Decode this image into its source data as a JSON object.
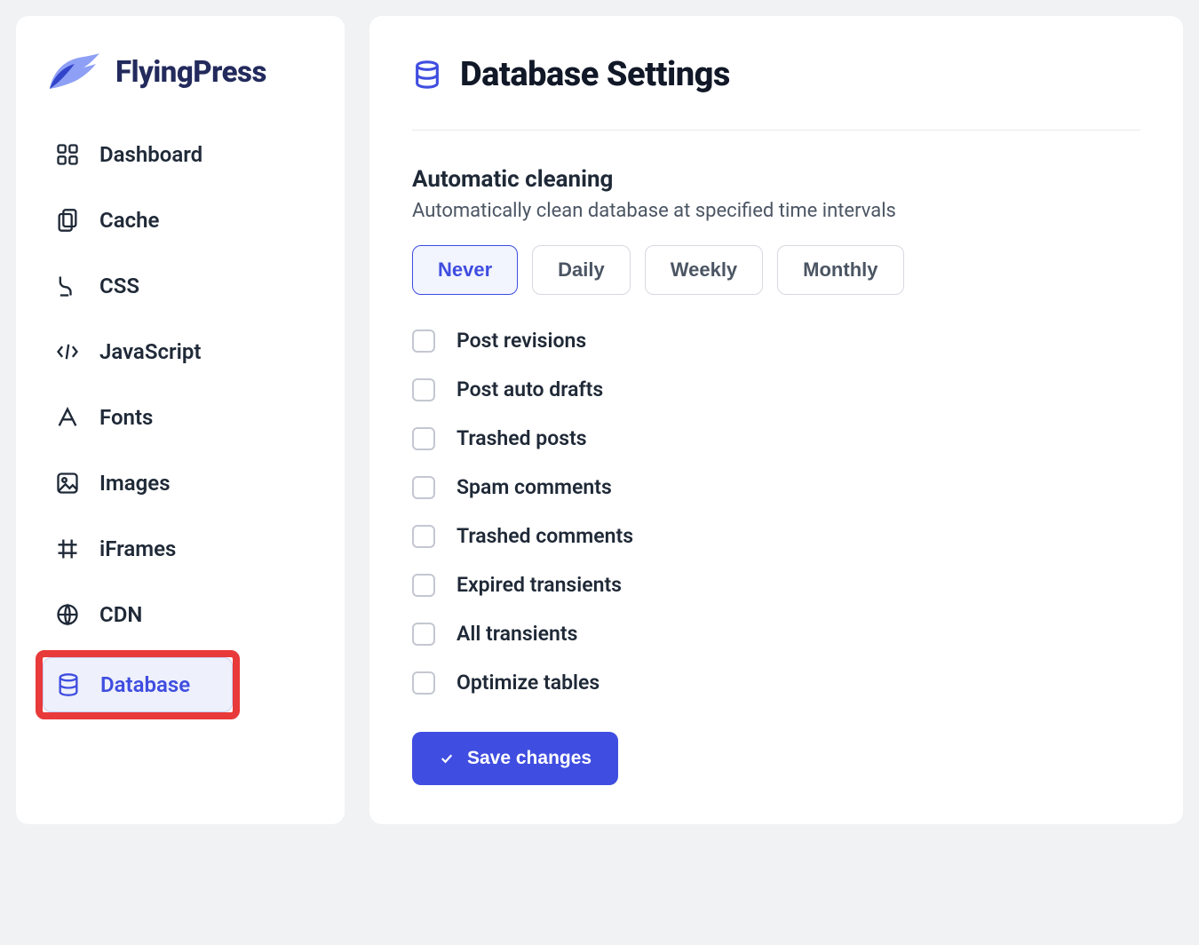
{
  "brand": {
    "name": "FlyingPress"
  },
  "sidebar": {
    "items": [
      {
        "key": "dashboard",
        "label": "Dashboard",
        "icon": "dashboard-icon",
        "active": false
      },
      {
        "key": "cache",
        "label": "Cache",
        "icon": "cache-icon",
        "active": false
      },
      {
        "key": "css",
        "label": "CSS",
        "icon": "css-icon",
        "active": false
      },
      {
        "key": "javascript",
        "label": "JavaScript",
        "icon": "javascript-icon",
        "active": false
      },
      {
        "key": "fonts",
        "label": "Fonts",
        "icon": "fonts-icon",
        "active": false
      },
      {
        "key": "images",
        "label": "Images",
        "icon": "images-icon",
        "active": false
      },
      {
        "key": "iframes",
        "label": "iFrames",
        "icon": "iframes-icon",
        "active": false
      },
      {
        "key": "cdn",
        "label": "CDN",
        "icon": "cdn-icon",
        "active": false
      },
      {
        "key": "database",
        "label": "Database",
        "icon": "database-icon",
        "active": true,
        "highlighted": true
      }
    ]
  },
  "page": {
    "title": "Database Settings",
    "section_title": "Automatic cleaning",
    "section_desc": "Automatically clean database at specified time intervals",
    "intervals": [
      {
        "label": "Never",
        "selected": true
      },
      {
        "label": "Daily",
        "selected": false
      },
      {
        "label": "Weekly",
        "selected": false
      },
      {
        "label": "Monthly",
        "selected": false
      }
    ],
    "options": [
      {
        "label": "Post revisions",
        "checked": false
      },
      {
        "label": "Post auto drafts",
        "checked": false
      },
      {
        "label": "Trashed posts",
        "checked": false
      },
      {
        "label": "Spam comments",
        "checked": false
      },
      {
        "label": "Trashed comments",
        "checked": false
      },
      {
        "label": "Expired transients",
        "checked": false
      },
      {
        "label": "All transients",
        "checked": false
      },
      {
        "label": "Optimize tables",
        "checked": false
      }
    ],
    "save_label": "Save changes"
  }
}
